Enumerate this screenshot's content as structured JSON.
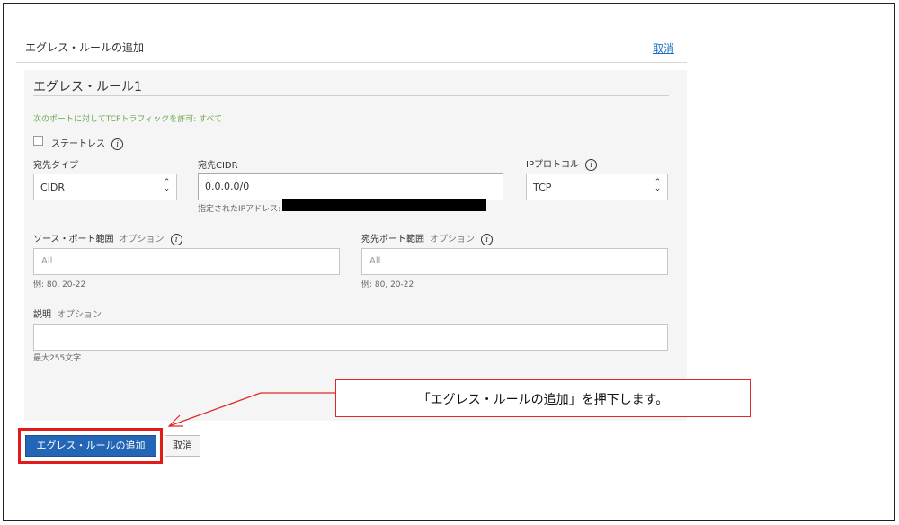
{
  "dialog": {
    "title": "エグレス・ルールの追加",
    "cancel_link": "取消"
  },
  "rule": {
    "title": "エグレス・ルール1",
    "summary": "次のポートに対してTCPトラフィックを許可: すべて",
    "stateless": {
      "label": "ステートレス",
      "checked": false
    },
    "destination_type": {
      "label": "宛先タイプ",
      "value": "CIDR"
    },
    "destination_cidr": {
      "label": "宛先CIDR",
      "value": "0.0.0.0/0",
      "hint": "指定されたIPアドレス:"
    },
    "ip_protocol": {
      "label": "IPプロトコル",
      "value": "TCP"
    },
    "source_port": {
      "label": "ソース・ポート範囲",
      "optional": "オプション",
      "placeholder": "All",
      "hint": "例: 80, 20-22"
    },
    "dest_port": {
      "label": "宛先ポート範囲",
      "optional": "オプション",
      "placeholder": "All",
      "hint": "例: 80, 20-22"
    },
    "description": {
      "label": "説明",
      "optional": "オプション",
      "value": "",
      "hint": "最大255文字"
    }
  },
  "footer": {
    "add_button": "エグレス・ルールの追加",
    "cancel_button": "取消"
  },
  "annotation": {
    "callout_text": "「エグレス・ルールの追加」を押下します。",
    "highlight_color": "#e11a1a"
  },
  "icons": {
    "info": "info-icon",
    "select": "chevron-updown-icon"
  },
  "colors": {
    "primary_button": "#2366b5",
    "link": "#1a6fc0",
    "summary_text": "#6aa84f"
  }
}
